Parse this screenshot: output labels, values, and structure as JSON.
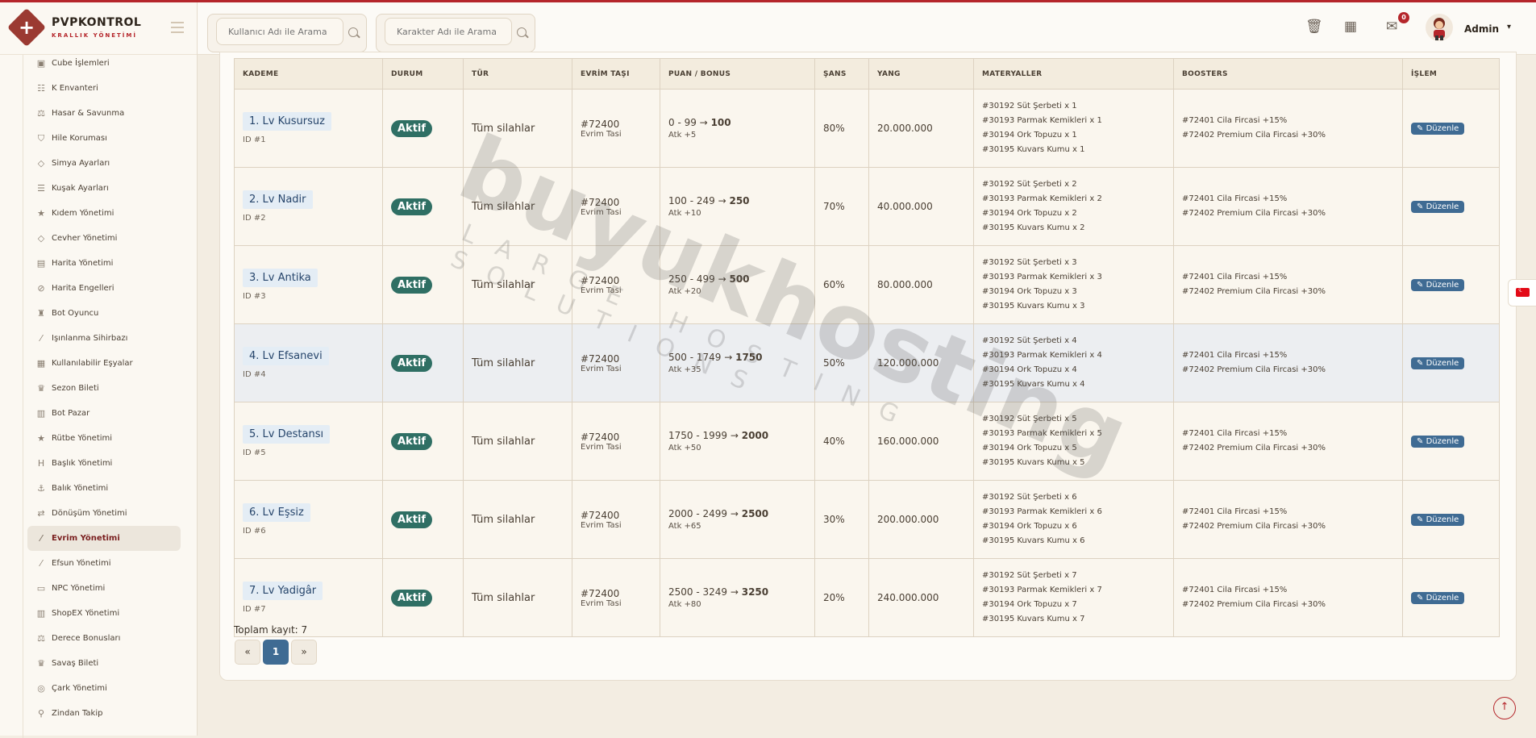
{
  "brand": {
    "title": "PVPKONTROL",
    "subtitle": "KRALLIK YÖNETİMİ"
  },
  "header": {
    "search_user_placeholder": "Kullanıcı Adı ile Arama",
    "search_char_placeholder": "Karakter Adı ile Arama",
    "mail_badge": "0",
    "admin_name": "Admin"
  },
  "sidebar": {
    "items": [
      {
        "label": "Cube İşlemleri",
        "icon": "cube-icon"
      },
      {
        "label": "K Envanteri",
        "icon": "inventory-icon"
      },
      {
        "label": "Hasar & Savunma",
        "icon": "balance-icon"
      },
      {
        "label": "Hile Koruması",
        "icon": "shield-icon"
      },
      {
        "label": "Simya Ayarları",
        "icon": "gem-icon"
      },
      {
        "label": "Kuşak Ayarları",
        "icon": "sliders-icon"
      },
      {
        "label": "Kıdem Yönetimi",
        "icon": "star-icon"
      },
      {
        "label": "Cevher Yönetimi",
        "icon": "gem-icon"
      },
      {
        "label": "Harita Yönetimi",
        "icon": "map-icon"
      },
      {
        "label": "Harita Engelleri",
        "icon": "ban-icon"
      },
      {
        "label": "Bot Oyuncu",
        "icon": "robot-icon"
      },
      {
        "label": "Işınlanma Sihirbazı",
        "icon": "wand-icon"
      },
      {
        "label": "Kullanılabilir Eşyalar",
        "icon": "box-icon"
      },
      {
        "label": "Sezon Bileti",
        "icon": "trophy-icon"
      },
      {
        "label": "Bot Pazar",
        "icon": "shop-icon"
      },
      {
        "label": "Rütbe Yönetimi",
        "icon": "star-icon"
      },
      {
        "label": "Başlık Yönetimi",
        "icon": "heading-icon"
      },
      {
        "label": "Balık Yönetimi",
        "icon": "anchor-icon"
      },
      {
        "label": "Dönüşüm Yönetimi",
        "icon": "shuffle-icon"
      },
      {
        "label": "Evrim Yönetimi",
        "icon": "wand-icon"
      },
      {
        "label": "Efsun Yönetimi",
        "icon": "wand-icon"
      },
      {
        "label": "NPC Yönetimi",
        "icon": "id-card-icon"
      },
      {
        "label": "ShopEX Yönetimi",
        "icon": "shop-icon"
      },
      {
        "label": "Derece Bonusları",
        "icon": "balance-icon"
      },
      {
        "label": "Savaş Bileti",
        "icon": "trophy-icon"
      },
      {
        "label": "Çark Yönetimi",
        "icon": "globe-icon"
      },
      {
        "label": "Zindan Takip",
        "icon": "pin-icon"
      }
    ]
  },
  "table": {
    "headers": [
      "KADEME",
      "DURUM",
      "TÜR",
      "EVRİM TAŞI",
      "PUAN / BONUS",
      "ŞANS",
      "YANG",
      "MATERYALLER",
      "BOOSTERS",
      "İŞLEM"
    ],
    "rows": [
      {
        "name": "1. Lv Kusursuz",
        "id": "ID #1",
        "status": "Aktif",
        "type": "Tüm silahlar",
        "evo_code": "#72400",
        "evo_name": "Evrim Tasi",
        "range": "0 - 99 →",
        "target": "100",
        "atk": "Atk +5",
        "chance": "80%",
        "yang": "20.000.000",
        "materials": [
          "#30192 Süt Şerbeti x 1",
          "#30193 Parmak Kemikleri x 1",
          "#30194 Ork Topuzu x 1",
          "#30195 Kuvars Kumu x 1"
        ],
        "boosters": [
          "#72401 Cila Fircasi +15%",
          "#72402 Premium Cila Fircasi +30%"
        ],
        "action": "Düzenle"
      },
      {
        "name": "2. Lv Nadir",
        "id": "ID #2",
        "status": "Aktif",
        "type": "Tüm silahlar",
        "evo_code": "#72400",
        "evo_name": "Evrim Tasi",
        "range": "100 - 249 →",
        "target": "250",
        "atk": "Atk +10",
        "chance": "70%",
        "yang": "40.000.000",
        "materials": [
          "#30192 Süt Şerbeti x 2",
          "#30193 Parmak Kemikleri x 2",
          "#30194 Ork Topuzu x 2",
          "#30195 Kuvars Kumu x 2"
        ],
        "boosters": [
          "#72401 Cila Fircasi +15%",
          "#72402 Premium Cila Fircasi +30%"
        ],
        "action": "Düzenle"
      },
      {
        "name": "3. Lv Antika",
        "id": "ID #3",
        "status": "Aktif",
        "type": "Tüm silahlar",
        "evo_code": "#72400",
        "evo_name": "Evrim Tasi",
        "range": "250 - 499 →",
        "target": "500",
        "atk": "Atk +20",
        "chance": "60%",
        "yang": "80.000.000",
        "materials": [
          "#30192 Süt Şerbeti x 3",
          "#30193 Parmak Kemikleri x 3",
          "#30194 Ork Topuzu x 3",
          "#30195 Kuvars Kumu x 3"
        ],
        "boosters": [
          "#72401 Cila Fircasi +15%",
          "#72402 Premium Cila Fircasi +30%"
        ],
        "action": "Düzenle"
      },
      {
        "name": "4. Lv Efsanevi",
        "id": "ID #4",
        "status": "Aktif",
        "type": "Tüm silahlar",
        "evo_code": "#72400",
        "evo_name": "Evrim Tasi",
        "range": "500 - 1749 →",
        "target": "1750",
        "atk": "Atk +35",
        "chance": "50%",
        "yang": "120.000.000",
        "materials": [
          "#30192 Süt Şerbeti x 4",
          "#30193 Parmak Kemikleri x 4",
          "#30194 Ork Topuzu x 4",
          "#30195 Kuvars Kumu x 4"
        ],
        "boosters": [
          "#72401 Cila Fircasi +15%",
          "#72402 Premium Cila Fircasi +30%"
        ],
        "action": "Düzenle"
      },
      {
        "name": "5. Lv Destansı",
        "id": "ID #5",
        "status": "Aktif",
        "type": "Tüm silahlar",
        "evo_code": "#72400",
        "evo_name": "Evrim Tasi",
        "range": "1750 - 1999 →",
        "target": "2000",
        "atk": "Atk +50",
        "chance": "40%",
        "yang": "160.000.000",
        "materials": [
          "#30192 Süt Şerbeti x 5",
          "#30193 Parmak Kemikleri x 5",
          "#30194 Ork Topuzu x 5",
          "#30195 Kuvars Kumu x 5"
        ],
        "boosters": [
          "#72401 Cila Fircasi +15%",
          "#72402 Premium Cila Fircasi +30%"
        ],
        "action": "Düzenle"
      },
      {
        "name": "6. Lv Eşsiz",
        "id": "ID #6",
        "status": "Aktif",
        "type": "Tüm silahlar",
        "evo_code": "#72400",
        "evo_name": "Evrim Tasi",
        "range": "2000 - 2499 →",
        "target": "2500",
        "atk": "Atk +65",
        "chance": "30%",
        "yang": "200.000.000",
        "materials": [
          "#30192 Süt Şerbeti x 6",
          "#30193 Parmak Kemikleri x 6",
          "#30194 Ork Topuzu x 6",
          "#30195 Kuvars Kumu x 6"
        ],
        "boosters": [
          "#72401 Cila Fircasi +15%",
          "#72402 Premium Cila Fircasi +30%"
        ],
        "action": "Düzenle"
      },
      {
        "name": "7. Lv Yadigâr",
        "id": "ID #7",
        "status": "Aktif",
        "type": "Tüm silahlar",
        "evo_code": "#72400",
        "evo_name": "Evrim Tasi",
        "range": "2500 - 3249 →",
        "target": "3250",
        "atk": "Atk +80",
        "chance": "20%",
        "yang": "240.000.000",
        "materials": [
          "#30192 Süt Şerbeti x 7",
          "#30193 Parmak Kemikleri x 7",
          "#30194 Ork Topuzu x 7",
          "#30195 Kuvars Kumu x 7"
        ],
        "boosters": [
          "#72401 Cila Fircasi +15%",
          "#72402 Premium Cila Fircasi +30%"
        ],
        "action": "Düzenle"
      }
    ]
  },
  "footer": {
    "total_label": "Toplam kayıt: 7"
  },
  "pagination": {
    "prev": "«",
    "current": "1",
    "next": "»"
  },
  "watermark": {
    "main": "buyukhosting",
    "sub": "LARGE HOSTING SOLUTIONS"
  },
  "colors": {
    "accent": "#b5262b",
    "status": "#2f6f64",
    "button": "#3f6b93"
  }
}
